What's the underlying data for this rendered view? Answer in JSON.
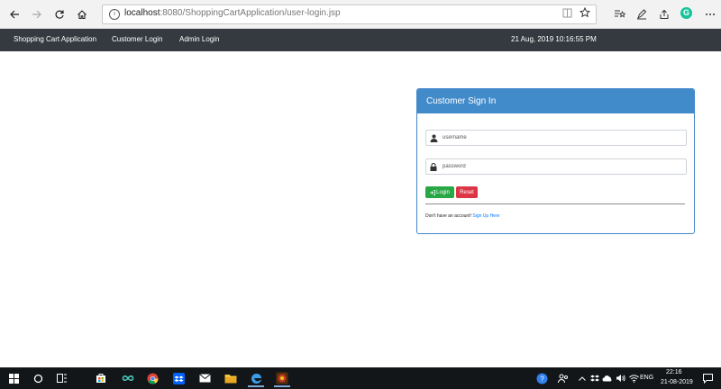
{
  "browser": {
    "url_host": "localhost",
    "url_path": ":8080/ShoppingCartApplication/user-login.jsp"
  },
  "navbar": {
    "brand": "Shopping Cart Application",
    "links": [
      "Customer Login",
      "Admin Login"
    ],
    "datetime": "21 Aug, 2019 10:16:55 PM"
  },
  "signin": {
    "title": "Customer Sign In",
    "username_placeholder": "username",
    "password_placeholder": "password",
    "login_label": "Login",
    "reset_label": "Reset",
    "signup_prompt": "Don't have an account!",
    "signup_link": "Sign Up Here"
  },
  "taskbar": {
    "language": "ENG",
    "time": "22:16",
    "date": "21-08-2019"
  },
  "colors": {
    "navbar_bg": "#343a40",
    "card_header": "#428bca",
    "login_btn": "#28a745",
    "reset_btn": "#dc3545",
    "link": "#007bff"
  }
}
